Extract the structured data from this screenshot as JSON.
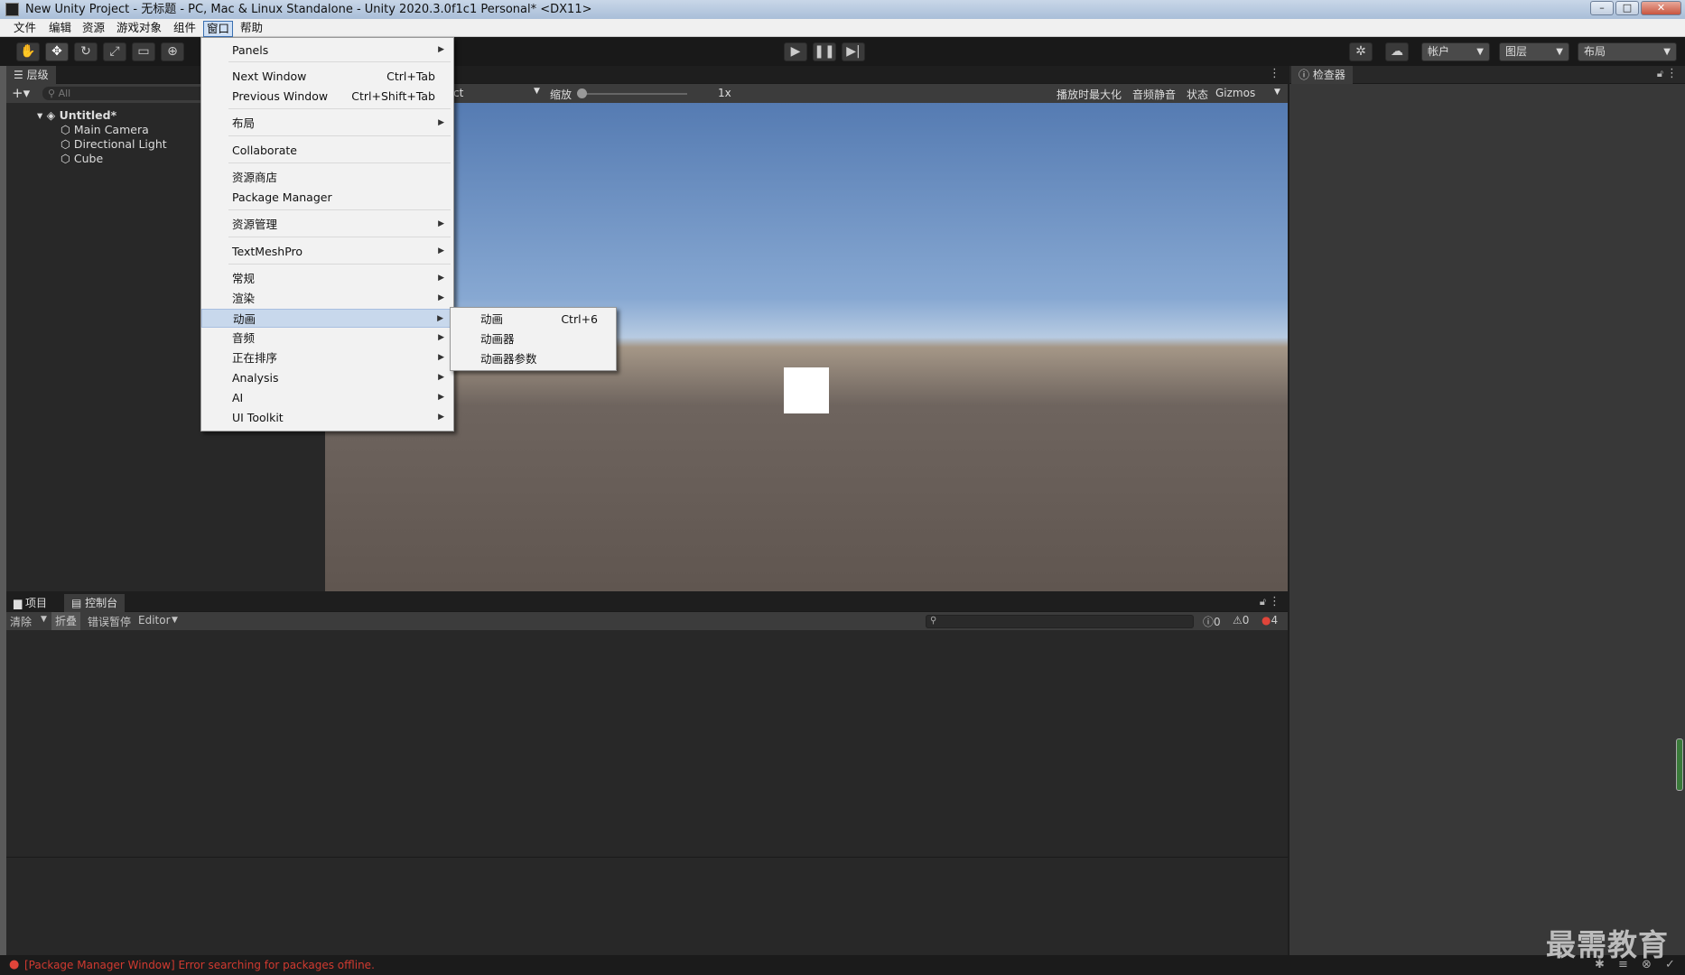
{
  "window": {
    "title": "New Unity Project - 无标题 - PC, Mac & Linux Standalone - Unity 2020.3.0f1c1 Personal* <DX11>",
    "minimize": "–",
    "maximize": "□",
    "close": "✕"
  },
  "menubar": [
    "文件",
    "编辑",
    "资源",
    "游戏对象",
    "组件",
    "窗口",
    "帮助"
  ],
  "toolbar": {
    "account": "帐户",
    "layers": "图层",
    "layout": "布局"
  },
  "hierarchy": {
    "tab": "层级",
    "search_placeholder": "All",
    "scene": "Untitled*",
    "items": [
      "Main Camera",
      "Directional Light",
      "Cube"
    ]
  },
  "scene": {
    "shading": "ct",
    "zoom_label": "缩放",
    "zoom_value": "1x",
    "maximize_on_play": "播放时最大化",
    "mute_audio": "音频静音",
    "stats": "状态",
    "gizmos": "Gizmos"
  },
  "inspector": {
    "tab": "检查器"
  },
  "bottom": {
    "tab_project": "项目",
    "tab_console": "控制台",
    "clear": "清除",
    "collapse": "折叠",
    "error_pause": "错误暂停",
    "editor": "Editor",
    "log_count": "0",
    "warn_count": "0",
    "error_count": "4"
  },
  "window_menu": {
    "items": [
      {
        "label": "Panels",
        "shortcut": "",
        "arrow": true
      },
      {
        "label": "Next Window",
        "shortcut": "Ctrl+Tab",
        "arrow": false
      },
      {
        "label": "Previous Window",
        "shortcut": "Ctrl+Shift+Tab",
        "arrow": false
      },
      {
        "label": "布局",
        "shortcut": "",
        "arrow": true
      },
      {
        "label": "Collaborate",
        "shortcut": "",
        "arrow": false
      },
      {
        "label": "资源商店",
        "shortcut": "",
        "arrow": false
      },
      {
        "label": "Package Manager",
        "shortcut": "",
        "arrow": false
      },
      {
        "label": "资源管理",
        "shortcut": "",
        "arrow": true
      },
      {
        "label": "TextMeshPro",
        "shortcut": "",
        "arrow": true
      },
      {
        "label": "常规",
        "shortcut": "",
        "arrow": true
      },
      {
        "label": "渲染",
        "shortcut": "",
        "arrow": true
      },
      {
        "label": "动画",
        "shortcut": "",
        "arrow": true
      },
      {
        "label": "音频",
        "shortcut": "",
        "arrow": true
      },
      {
        "label": "正在排序",
        "shortcut": "",
        "arrow": true
      },
      {
        "label": "Analysis",
        "shortcut": "",
        "arrow": true
      },
      {
        "label": "AI",
        "shortcut": "",
        "arrow": true
      },
      {
        "label": "UI Toolkit",
        "shortcut": "",
        "arrow": true
      }
    ]
  },
  "animation_submenu": {
    "items": [
      {
        "label": "动画",
        "shortcut": "Ctrl+6"
      },
      {
        "label": "动画器",
        "shortcut": ""
      },
      {
        "label": "动画器参数",
        "shortcut": ""
      }
    ]
  },
  "status": {
    "message": "[Package Manager Window] Error searching for packages offline."
  },
  "watermark": "最需教育",
  "colors": {
    "error": "#e0453a",
    "menu_highlight": "#c8d8ec",
    "panel": "#282828"
  }
}
